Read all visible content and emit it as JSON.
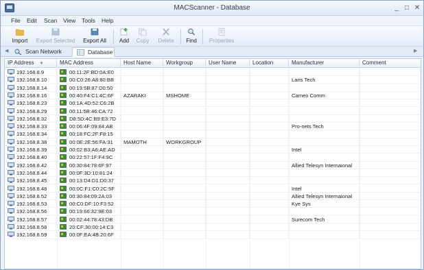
{
  "window": {
    "title": "MACScanner - Database"
  },
  "menu": [
    "File",
    "Edit",
    "Scan",
    "View",
    "Tools",
    "Help"
  ],
  "toolbar": {
    "import": "Import",
    "export_selected": "Export Selected",
    "export_all": "Export All",
    "add": "Add",
    "copy": "Copy",
    "delete": "Delete",
    "find": "Find",
    "properties": "Properties"
  },
  "tabs": {
    "scan_network": "Scan Network",
    "database": "Database"
  },
  "columns": [
    "IP Address",
    "MAC Address",
    "Host Name",
    "Workgroup",
    "User Name",
    "Location",
    "Manufacturer",
    "Comment"
  ],
  "rows": [
    {
      "ip": "192.168.8.9",
      "mac": "00:11:2F:BD:0A:E0",
      "host": "",
      "wg": "",
      "user": "",
      "loc": "",
      "mfr": "",
      "comment": ""
    },
    {
      "ip": "192.168.8.10",
      "mac": "00:C0:26:A8:80:BB",
      "host": "",
      "wg": "",
      "user": "",
      "loc": "",
      "mfr": "Lans Tech",
      "comment": ""
    },
    {
      "ip": "192.168.8.14",
      "mac": "00:19:5B:87:D0:50",
      "host": "",
      "wg": "",
      "user": "",
      "loc": "",
      "mfr": "",
      "comment": ""
    },
    {
      "ip": "192.168.8.16",
      "mac": "00:40:F4:C1:4C:6F",
      "host": "AZARAKI",
      "wg": "MSHOME",
      "user": "",
      "loc": "",
      "mfr": "Cameo Comm",
      "comment": ""
    },
    {
      "ip": "192.168.8.23",
      "mac": "00:1A:4D:52:C6:2B",
      "host": "",
      "wg": "",
      "user": "",
      "loc": "",
      "mfr": "",
      "comment": ""
    },
    {
      "ip": "192.168.8.29",
      "mac": "00:11:5B:46:CA:72",
      "host": "",
      "wg": "",
      "user": "",
      "loc": "",
      "mfr": "",
      "comment": ""
    },
    {
      "ip": "192.168.8.32",
      "mac": "D8:5D:4C:B9:E3:7D",
      "host": "",
      "wg": "",
      "user": "",
      "loc": "",
      "mfr": "",
      "comment": ""
    },
    {
      "ip": "192.168.8.33",
      "mac": "00:06:4F:09:84:AB",
      "host": "",
      "wg": "",
      "user": "",
      "loc": "",
      "mfr": "Pro-nets Tech",
      "comment": ""
    },
    {
      "ip": "192.168.8.34",
      "mac": "00:18:FC:2F:F8:15",
      "host": "",
      "wg": "",
      "user": "",
      "loc": "",
      "mfr": "",
      "comment": ""
    },
    {
      "ip": "192.168.8.38",
      "mac": "00:0E:2E:56:FA:31",
      "host": "MAMOTH",
      "wg": "WORKGROUP",
      "user": "",
      "loc": "",
      "mfr": "",
      "comment": ""
    },
    {
      "ip": "192.168.8.39",
      "mac": "00:02:B3:A6:AE:AD",
      "host": "",
      "wg": "",
      "user": "",
      "loc": "",
      "mfr": "Intel",
      "comment": ""
    },
    {
      "ip": "192.168.8.40",
      "mac": "00:22:57:1F:F4:9C",
      "host": "",
      "wg": "",
      "user": "",
      "loc": "",
      "mfr": "",
      "comment": ""
    },
    {
      "ip": "192.168.8.42",
      "mac": "00:30:84:78:6F:97",
      "host": "",
      "wg": "",
      "user": "",
      "loc": "",
      "mfr": "Allied Telesyn Internaional",
      "comment": ""
    },
    {
      "ip": "192.168.8.44",
      "mac": "00:0F:3D:10:81:24",
      "host": "",
      "wg": "",
      "user": "",
      "loc": "",
      "mfr": "",
      "comment": ""
    },
    {
      "ip": "192.168.8.45",
      "mac": "00:13:D4:D1:D0:37",
      "host": "",
      "wg": "",
      "user": "",
      "loc": "",
      "mfr": "",
      "comment": ""
    },
    {
      "ip": "192.168.8.48",
      "mac": "00:0C:F1:C0:2C:5F",
      "host": "",
      "wg": "",
      "user": "",
      "loc": "",
      "mfr": "Intel",
      "comment": ""
    },
    {
      "ip": "192.168.8.52",
      "mac": "00:30:84:09:2A:03",
      "host": "",
      "wg": "",
      "user": "",
      "loc": "",
      "mfr": "Allied Telesyn Internaional",
      "comment": ""
    },
    {
      "ip": "192.168.8.53",
      "mac": "00:C0:DF:10:F3:52",
      "host": "",
      "wg": "",
      "user": "",
      "loc": "",
      "mfr": "Kye Sys",
      "comment": ""
    },
    {
      "ip": "192.168.8.56",
      "mac": "00:19:66:32:9E:03",
      "host": "",
      "wg": "",
      "user": "",
      "loc": "",
      "mfr": "",
      "comment": ""
    },
    {
      "ip": "192.168.8.57",
      "mac": "00:02:44:78:43:DB",
      "host": "",
      "wg": "",
      "user": "",
      "loc": "",
      "mfr": "Surecom Tech",
      "comment": ""
    },
    {
      "ip": "192.168.8.58",
      "mac": "20:CF:30:00:14:C3",
      "host": "",
      "wg": "",
      "user": "",
      "loc": "",
      "mfr": "",
      "comment": ""
    },
    {
      "ip": "192.168.8.59",
      "mac": "00:0F:EA:4B:20:6F",
      "host": "",
      "wg": "",
      "user": "",
      "loc": "",
      "mfr": "",
      "comment": ""
    }
  ]
}
